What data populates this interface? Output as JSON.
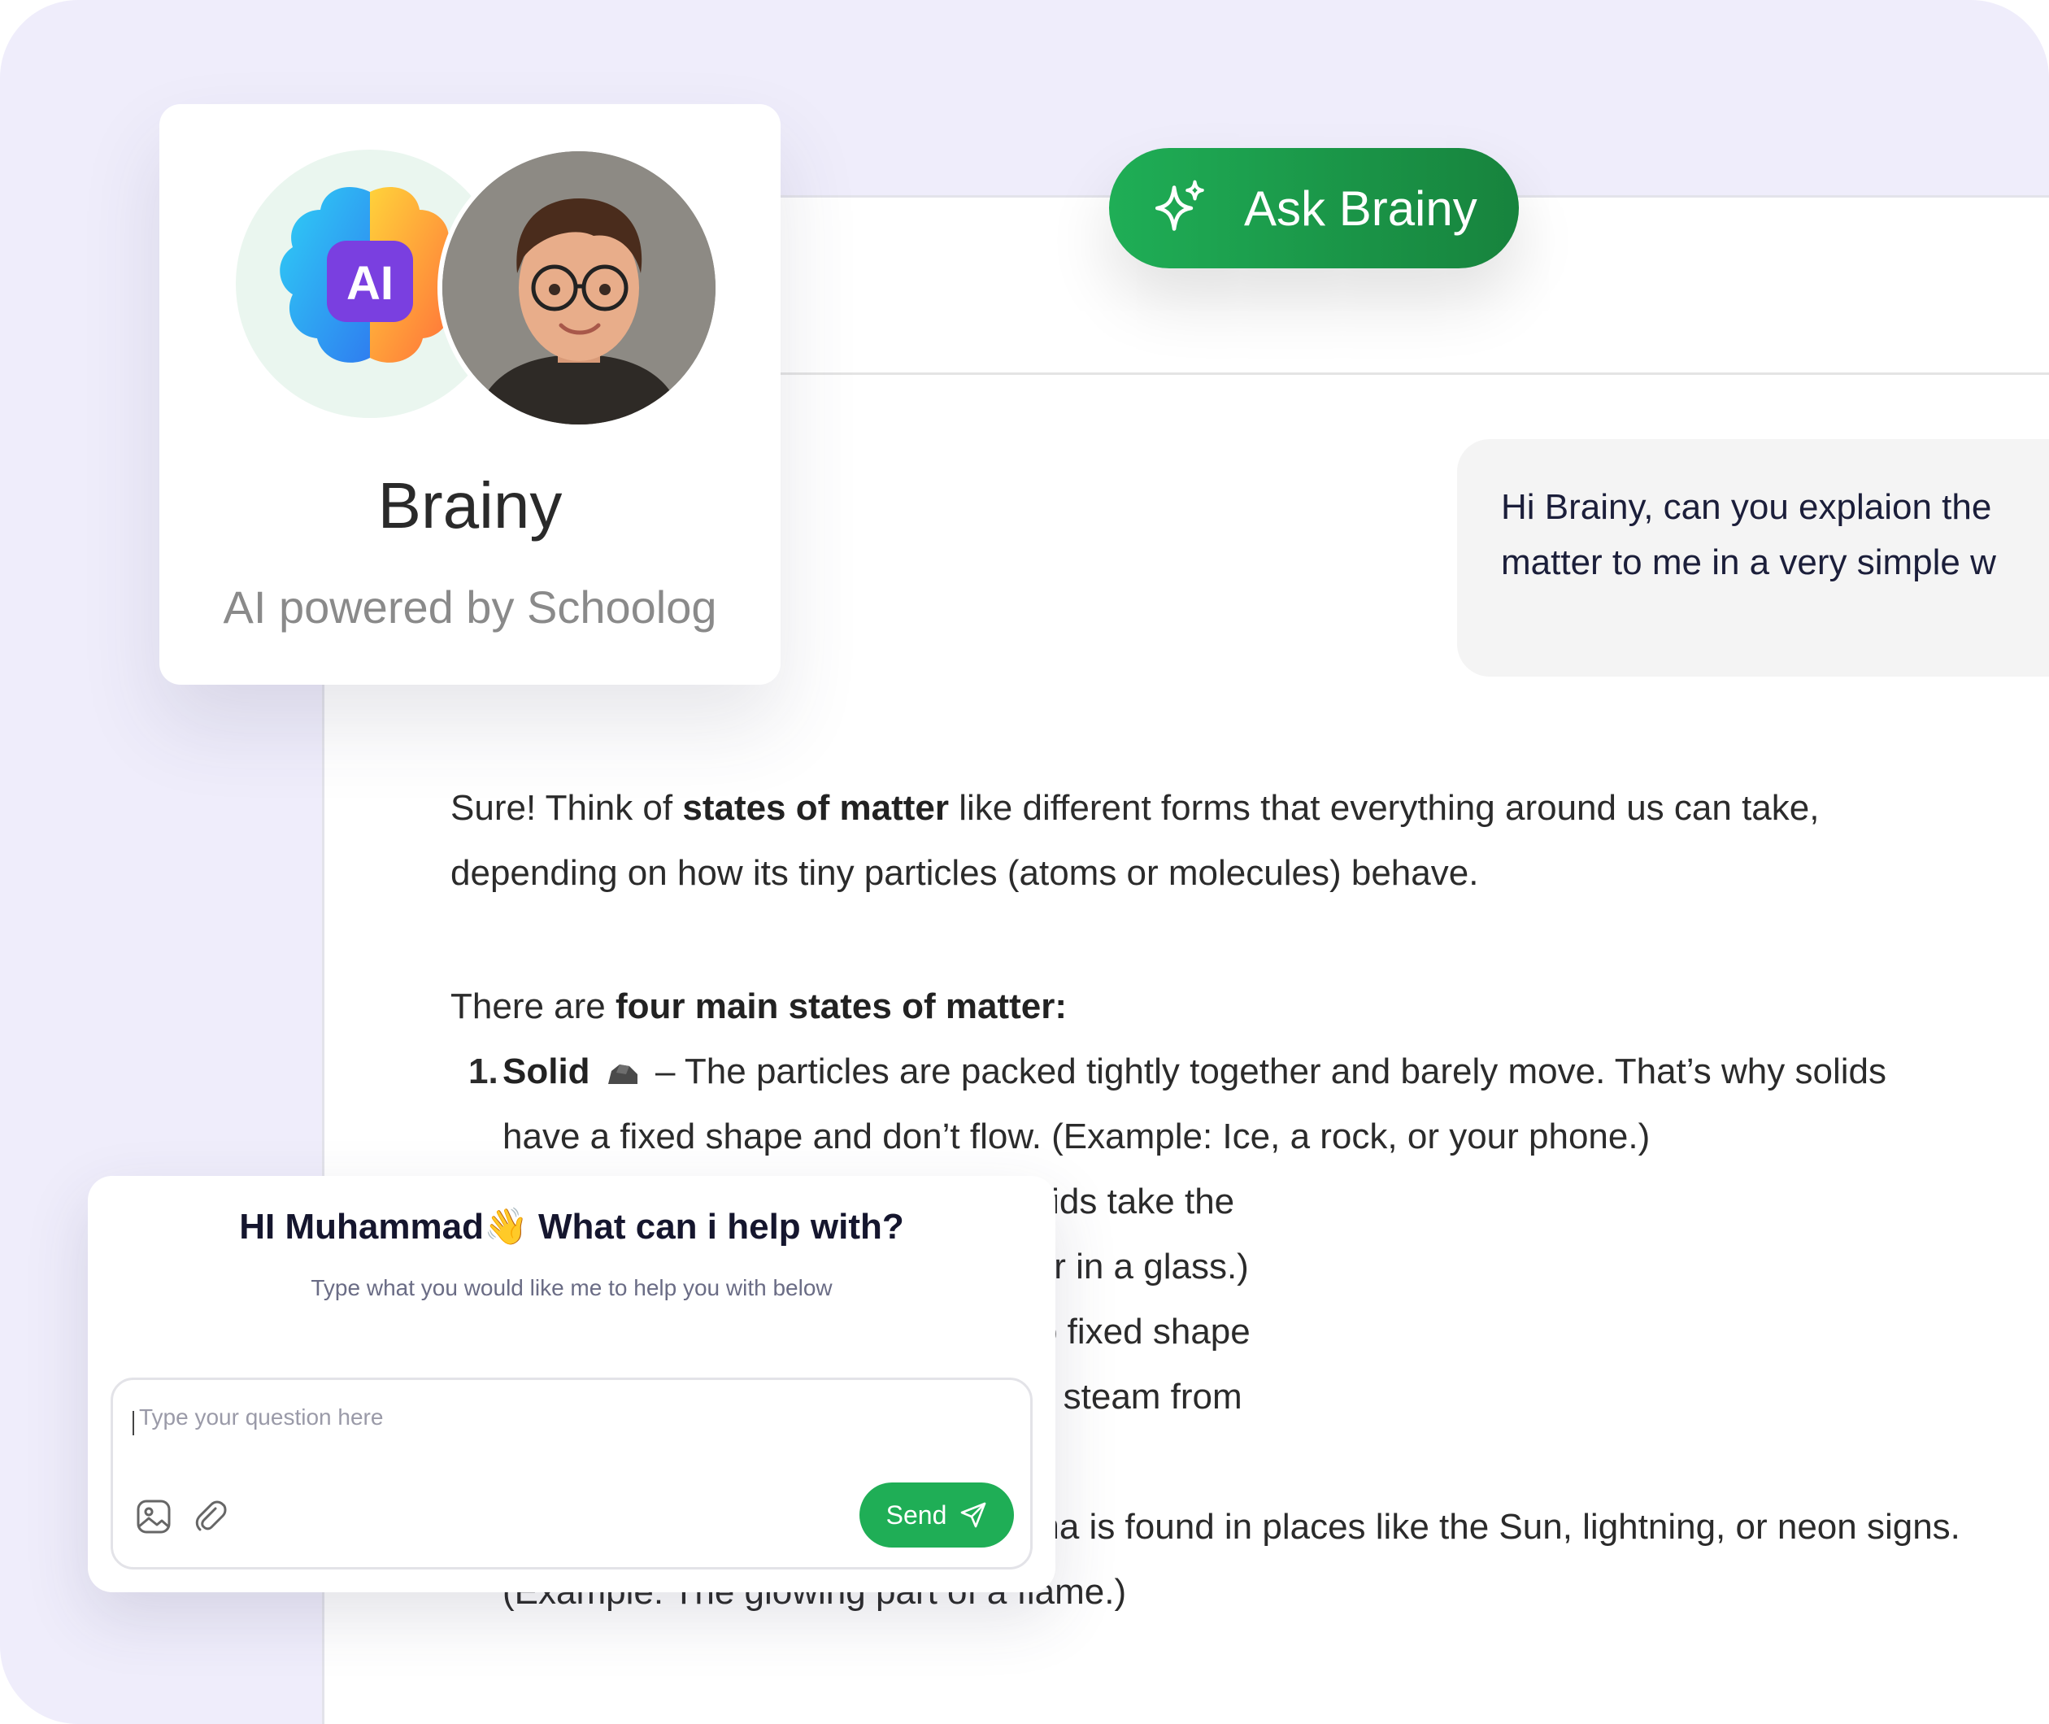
{
  "header": {
    "subtitle_fragment": "hoolog",
    "ask_button": "Ask Brainy"
  },
  "user_message": "Hi Brainy, can you explaion the\nmatter to me in a very simple w",
  "answer": {
    "p1_start": "Sure! Think of ",
    "p1_bold": "states of matter",
    "p1_rest": " like different forms that everything around us can take, depending on how its tiny particles (atoms or molecules) behave.",
    "p2_start": "There are ",
    "p2_bold": "four main states of matter:",
    "items": [
      {
        "num": "1.",
        "name": "Solid",
        "text": " – The particles are packed tightly together and barely move. That’s why solids have a fixed shape and don’t flow. (Example: Ice, a rock, or your phone.)"
      },
      {
        "text": "se but can move around a bit. Liquids take the"
      },
      {
        "text": "ve a fixed volume. (Example: Water in a glass.)"
      },
      {
        "text": "ely and spread out. Gases have no fixed shape"
      },
      {
        "text": "d to fill any space. (Example: Air or steam from"
      },
      {
        "text": "uper energetic and charged. Plasma is found in places like the Sun, lightning, or neon signs. (Example: The glowing part of a flame.)"
      }
    ]
  },
  "brainy_card": {
    "ai_badge": "AI",
    "name": "Brainy",
    "subtitle": "AI powered by Schoolog"
  },
  "chat_card": {
    "greeting": "HI Muhammad",
    "greeting_emoji": "👋",
    "greeting_rest": " What can i help with?",
    "subtitle": "Type what you would like me to help you with below",
    "placeholder": "Type your question here",
    "send_label": "Send"
  },
  "colors": {
    "accent_green": "#1fae56",
    "background_lavender": "#efedfb"
  },
  "icons": [
    "sparkle-icon",
    "image-icon",
    "paperclip-icon",
    "send-icon",
    "rock-emoji-icon",
    "wave-emoji-icon"
  ]
}
